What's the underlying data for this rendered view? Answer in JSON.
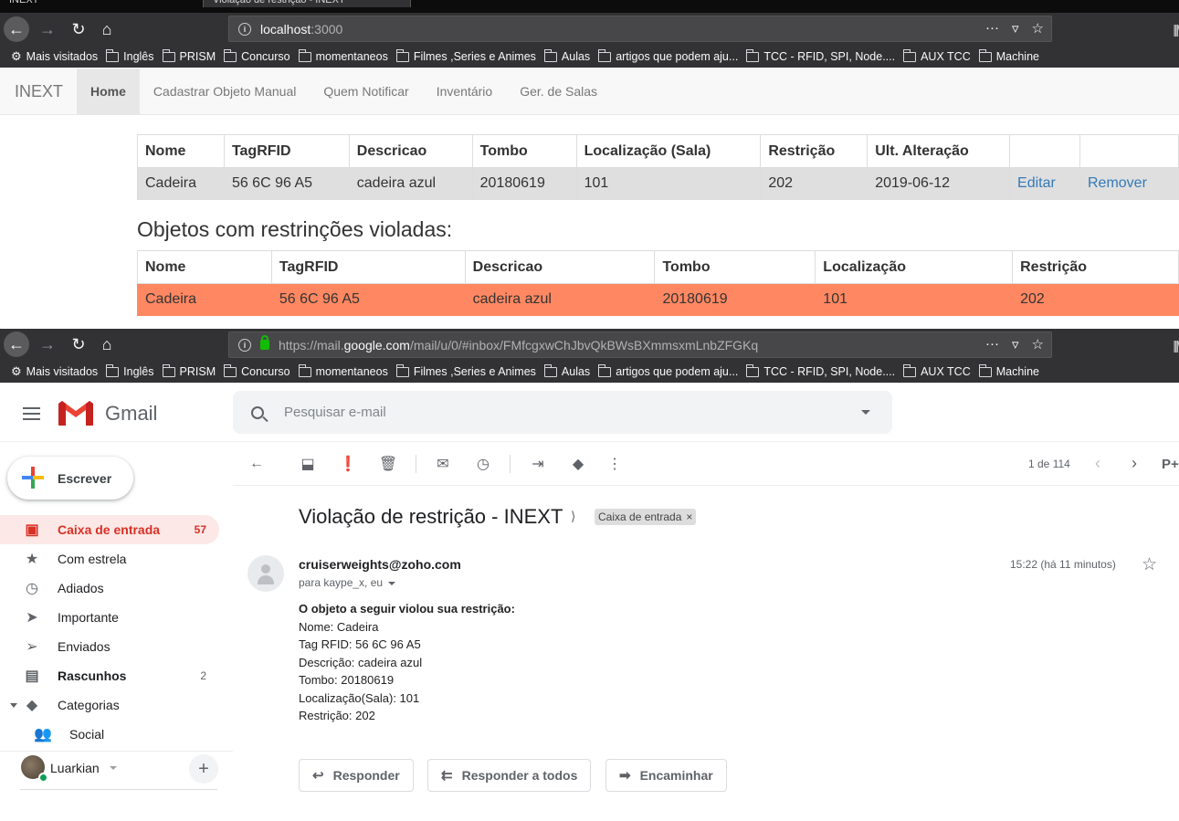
{
  "browser_top": {
    "tabs": [
      "INEXT",
      "Violação de restrição - INEXT"
    ],
    "url_host": "localhost",
    "url_port": ":3000"
  },
  "browser_bottom": {
    "url_prefix": "https://mail.",
    "url_host": "google.com",
    "url_path": "/mail/u/0/#inbox/FMfcgxwChJbvQkBWsBXmmsxmLnbZFGKq"
  },
  "bookmarks": [
    "Mais visitados",
    "Inglês",
    "PRISM",
    "Concurso",
    "momentaneos",
    "Filmes ,Series e Animes",
    "Aulas",
    "artigos que podem aju...",
    "TCC - RFID, SPI, Node....",
    "AUX TCC",
    "Machine"
  ],
  "inext": {
    "brand": "INEXT",
    "nav": [
      "Home",
      "Cadastrar Objeto Manual",
      "Quem Notificar",
      "Inventário",
      "Ger. de Salas"
    ],
    "table1": {
      "headers": [
        "Nome",
        "TagRFID",
        "Descricao",
        "Tombo",
        "Localização (Sala)",
        "Restrição",
        "Ult. Alteração",
        "",
        ""
      ],
      "row": [
        "Cadeira",
        "56 6C 96 A5",
        "cadeira azul",
        "20180619",
        "101",
        "202",
        "2019-06-12"
      ],
      "edit_label": "Editar",
      "remove_label": "Remover"
    },
    "violated_title": "Objetos com restrinções violadas:",
    "table2": {
      "headers": [
        "Nome",
        "TagRFID",
        "Descricao",
        "Tombo",
        "Localização",
        "Restrição"
      ],
      "row": [
        "Cadeira",
        "56 6C 96 A5",
        "cadeira azul",
        "20180619",
        "101",
        "202"
      ]
    },
    "danger_color": "#ff8862"
  },
  "gmail": {
    "product_name": "Gmail",
    "search_placeholder": "Pesquisar e-mail",
    "compose_label": "Escrever",
    "sidebar": [
      {
        "label": "Caixa de entrada",
        "count": "57",
        "icon": "inbox-icon"
      },
      {
        "label": "Com estrela",
        "count": "",
        "icon": "star-icon"
      },
      {
        "label": "Adiados",
        "count": "",
        "icon": "clock-icon"
      },
      {
        "label": "Importante",
        "count": "",
        "icon": "important-icon"
      },
      {
        "label": "Enviados",
        "count": "",
        "icon": "send-icon"
      },
      {
        "label": "Rascunhos",
        "count": "2",
        "icon": "draft-icon"
      },
      {
        "label": "Categorias",
        "count": "",
        "icon": "label-icon"
      },
      {
        "label": "Social",
        "count": "",
        "icon": "people-icon"
      }
    ],
    "user_name": "Luarkian",
    "pager": "1 de 114",
    "subject": "Violação de restrição - INEXT",
    "label_chip": "Caixa de entrada",
    "sender": "cruiserweights@zoho.com",
    "recipients": "para kaype_x, eu",
    "time": "15:22 (há 11 minutos)",
    "body": [
      "O objeto a seguir violou sua restrição:",
      "Nome: Cadeira",
      "Tag RFID: 56 6C 96 A5",
      "Descrição: cadeira azul",
      "Tombo: 20180619",
      "Localização(Sala): 101",
      "Restrição: 202"
    ],
    "actions": [
      "Responder",
      "Responder a todos",
      "Encaminhar"
    ],
    "accent_color": "#d93025"
  }
}
